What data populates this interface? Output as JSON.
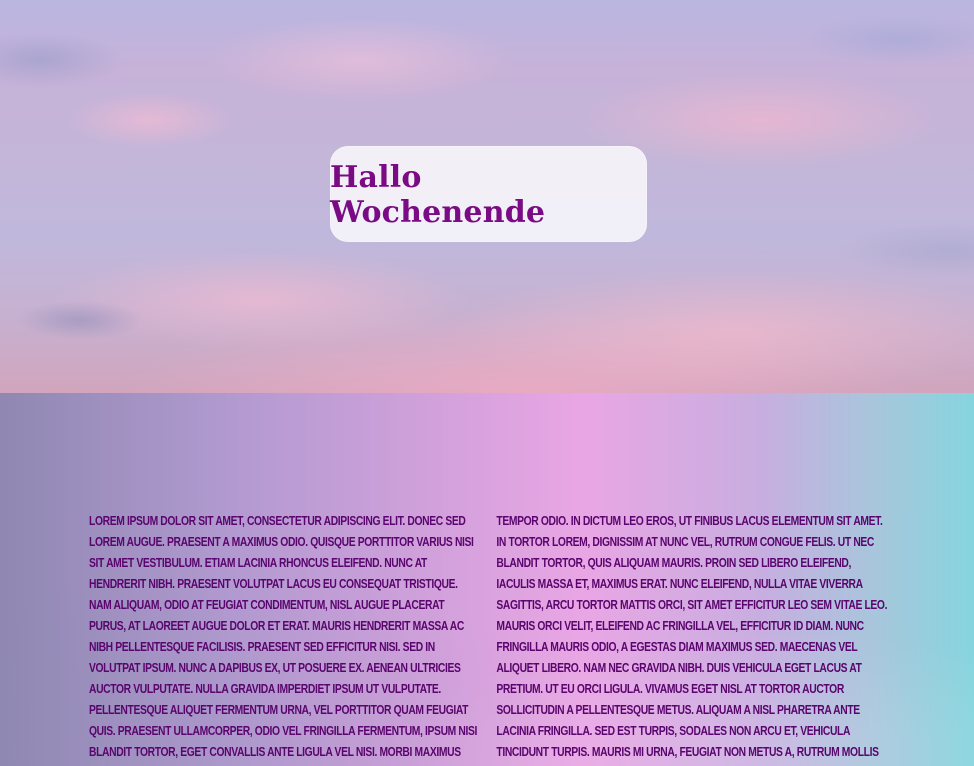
{
  "hero": {
    "title": "Hallo Wochenende"
  },
  "content": {
    "paragraph": "Lorem ipsum dolor sit amet, consectetur adipiscing elit. Donec sed lorem augue. Praesent a maximus odio. Quisque porttitor varius nisi sit amet vestibulum. Etiam lacinia rhoncus eleifend. Nunc at hendrerit nibh. Praesent volutpat lacus eu consequat tristique. Nam aliquam, odio at feugiat condimentum, nisl augue placerat purus, at laoreet augue dolor et erat. Mauris hendrerit massa ac nibh pellentesque facilisis. Praesent sed efficitur nisi. Sed in volutpat ipsum. Nunc a dapibus ex, ut posuere ex. Aenean ultricies auctor vulputate. Nulla gravida imperdiet ipsum ut vulputate. Pellentesque aliquet fermentum urna, vel porttitor quam feugiat quis. Praesent ullamcorper, odio vel fringilla fermentum, ipsum nisi blandit tortor, eget convallis ante ligula vel nisi. Morbi maximus dignissim lorem, in molestie tellus venenatis et. Vestibulum vitae tempor odio. In dictum leo eros, ut finibus lacus elementum sit amet. In tortor lorem, dignissim at nunc vel, rutrum congue felis. Ut nec blandit tortor, quis aliquam mauris. Proin sed libero eleifend, iaculis massa et, maximus erat. Nunc eleifend, nulla vitae viverra sagittis, arcu tortor mattis orci, sit amet efficitur leo sem vitae leo. Mauris orci velit, eleifend ac fringilla vel, efficitur id diam. Nunc fringilla mauris odio, a egestas diam maximus sed. Maecenas vel aliquet libero. Nam nec gravida nibh. Duis vehicula eget lacus at pretium. Ut eu orci ligula. Vivamus eget nisl at tortor auctor sollicitudin a pellentesque metus. Aliquam a nisl pharetra ante lacinia fringilla. Sed est turpis, sodales non arcu et, vehicula tincidunt turpis. Mauris mi urna, feugiat non metus a, rutrum mollis magna. Morbi at sollicitudin leo. Vivamus dictum euismod lectus"
  },
  "colors": {
    "title_text": "#7a0b84",
    "body_text": "#5a056d"
  }
}
